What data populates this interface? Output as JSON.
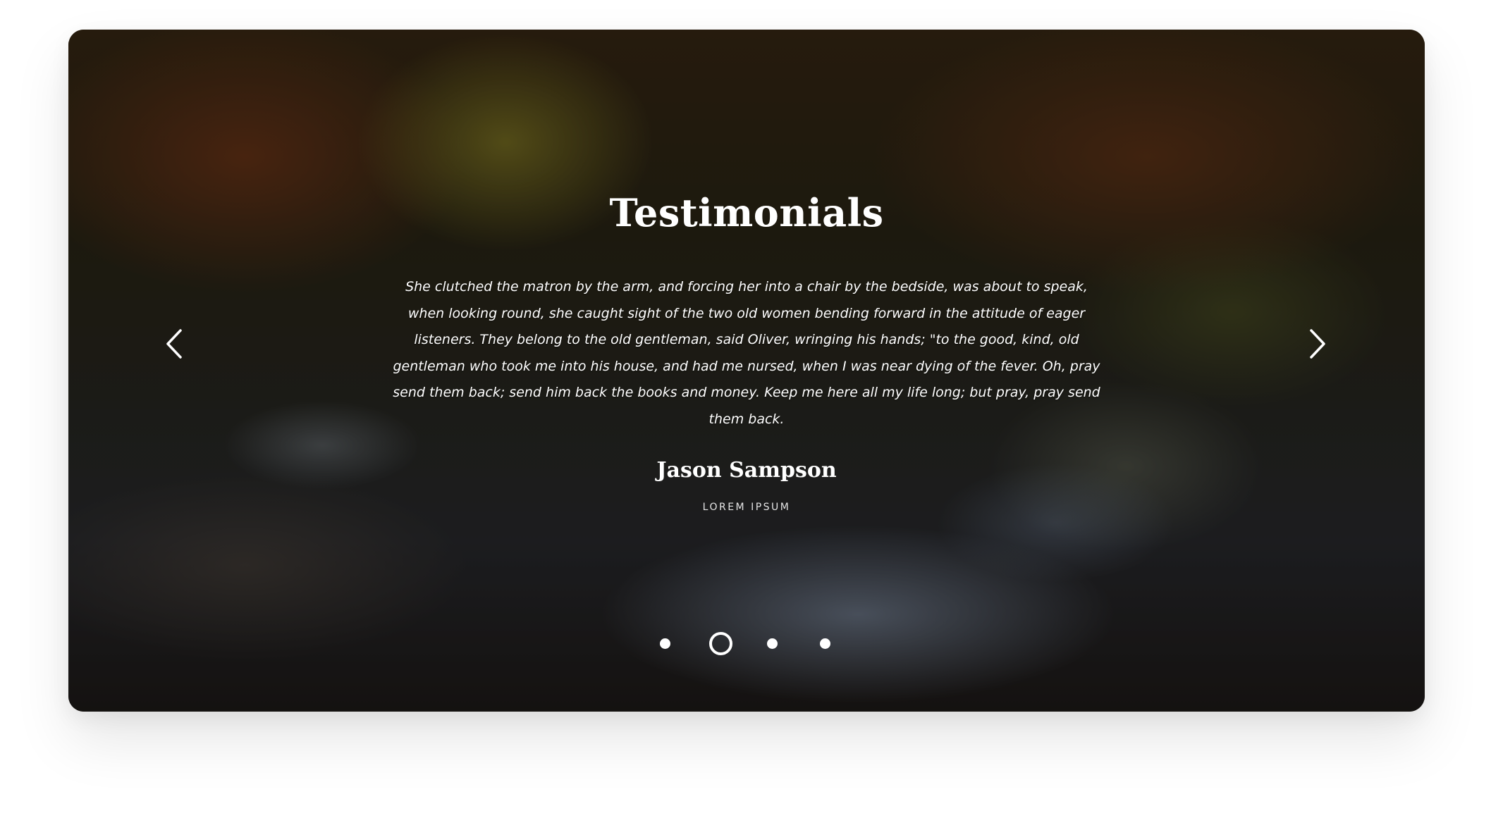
{
  "testimonials": {
    "title": "Testimonials",
    "quote": "She clutched the matron by the arm, and forcing her into a chair by the bedside, was about to speak, when looking round, she caught sight of the two old women bending forward in the attitude of eager listeners. They belong to the old gentleman, said Oliver, wringing his hands; \"to the good, kind, old gentleman who took me into his house, and had me nursed, when I was near dying of the fever. Oh, pray send them back; send him back the books and money. Keep me here all my life long; but pray, pray send them back.",
    "author": "Jason Sampson",
    "role": "LOREM IPSUM",
    "prev_icon": "chevron-left-icon",
    "next_icon": "chevron-right-icon",
    "pagination": {
      "total": 4,
      "active": 2
    }
  },
  "colors": {
    "text": "#ffffff",
    "role_text": "#e6e6e6",
    "page_background": "#ffffff"
  }
}
